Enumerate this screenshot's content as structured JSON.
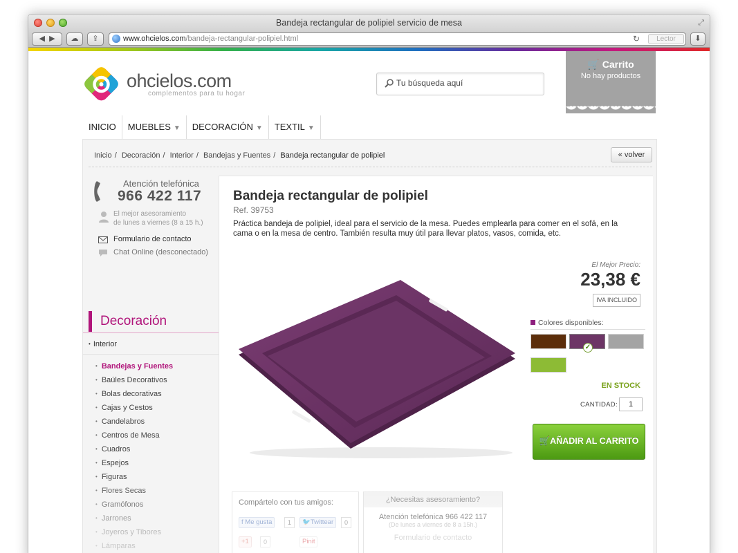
{
  "window": {
    "title": "Bandeja rectangular de polipiel servicio de mesa",
    "url_host": "www.ohcielos.com",
    "url_path": "/bandeja-rectangular-polipiel.html",
    "reader_label": "Lector"
  },
  "header": {
    "brand": "ohcielos.com",
    "tagline": "complementos para tu hogar",
    "search_placeholder": "Tu búsqueda aquí",
    "cart_title": "Carrito",
    "cart_status": "No hay productos"
  },
  "nav": {
    "items": [
      {
        "label": "INICIO",
        "has_menu": false
      },
      {
        "label": "MUEBLES",
        "has_menu": true
      },
      {
        "label": "DECORACIÓN",
        "has_menu": true
      },
      {
        "label": "TEXTIL",
        "has_menu": true
      }
    ]
  },
  "breadcrumb": {
    "items": [
      "Inicio",
      "Decoración",
      "Interior",
      "Bandejas y Fuentes"
    ],
    "current": "Bandeja rectangular de polipiel",
    "back_label": "« volver"
  },
  "contact": {
    "attention": "Atención telefónica",
    "phone": "966 422 117",
    "advice_line1": "El mejor asesoramiento",
    "advice_line2": "de lunes a viernes (8 a 15 h.)",
    "form_link": "Formulario de contacto",
    "chat": "Chat Online (desconectado)"
  },
  "sidebar": {
    "title": "Decoración",
    "section": "Interior",
    "items": [
      "Bandejas y Fuentes",
      "Baúles Decorativos",
      "Bolas decorativas",
      "Cajas y Cestos",
      "Candelabros",
      "Centros de Mesa",
      "Cuadros",
      "Espejos",
      "Figuras",
      "Flores Secas",
      "Gramófonos",
      "Jarrones",
      "Joyeros y Tibores",
      "Lámparas"
    ],
    "active_index": 0
  },
  "product": {
    "title": "Bandeja rectangular de polipiel",
    "ref": "Ref. 39753",
    "description": "Práctica bandeja de polipiel, ideal para el servicio de la mesa. Puedes emplearla para comer en el sofá, en la cama o en la mesa de centro. También resulta muy útil para llevar platos, vasos, comida, etc.",
    "price_label": "El Mejor Precio:",
    "price": "23,38 €",
    "tax_note": "IVA INCLUIDO",
    "colors_label": "Colores disponibles:",
    "colors": [
      {
        "name": "marrón",
        "hex": "#5c2e0a",
        "selected": false
      },
      {
        "name": "morado",
        "hex": "#6d3566",
        "selected": true
      },
      {
        "name": "gris",
        "hex": "#a4a4a4",
        "selected": false
      },
      {
        "name": "verde",
        "hex": "#8dbb35",
        "selected": false
      }
    ],
    "stock": "EN STOCK",
    "quantity_label": "CANTIDAD:",
    "quantity": "1",
    "add_to_cart": "AÑADIR AL CARRITO",
    "tray_color": "#6d3566"
  },
  "share": {
    "label": "Compártelo con tus amigos:",
    "facebook": "Me gusta",
    "facebook_count": "1",
    "twitter": "Twittear",
    "twitter_count": "0",
    "gplus": "+1",
    "gplus_count": "0",
    "pinterest": "Pinit"
  },
  "help": {
    "title": "¿Necesitas asesoramiento?",
    "line1": "Atención telefónica 966 422 117",
    "line2": "(De lunes a viernes de 8 a 15h.)",
    "line3": "Formulario de contacto"
  }
}
